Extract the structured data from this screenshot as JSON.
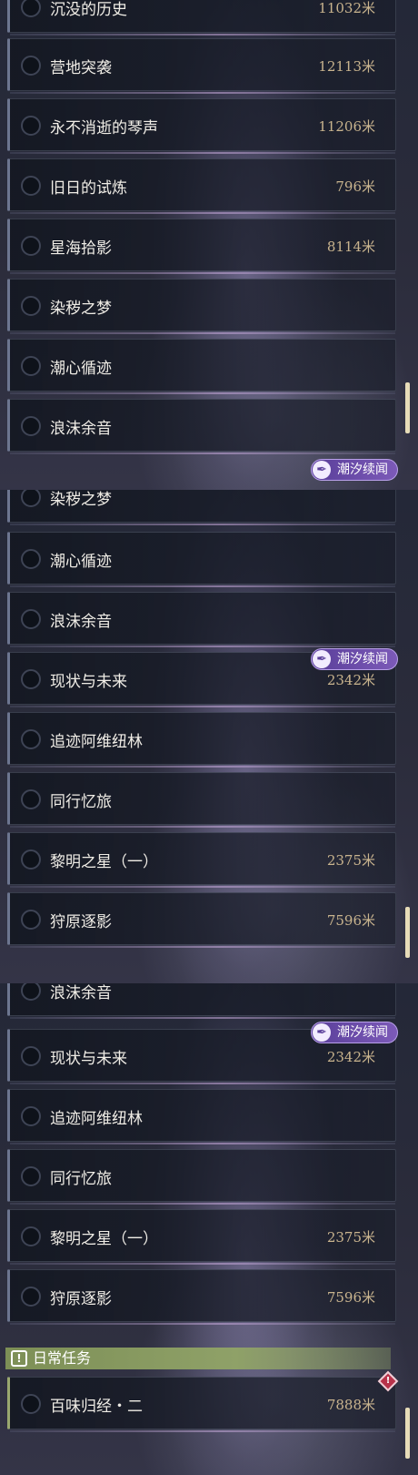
{
  "panels": [
    {
      "quests": [
        {
          "name": "沉没的历史",
          "distance": "11032米"
        },
        {
          "name": "营地突袭",
          "distance": "12113米"
        },
        {
          "name": "永不消逝的琴声",
          "distance": "11206米"
        },
        {
          "name": "旧日的试炼",
          "distance": "796米"
        },
        {
          "name": "星海拾影",
          "distance": "8114米"
        },
        {
          "name": "染秽之梦",
          "distance": ""
        },
        {
          "name": "潮心循迹",
          "distance": ""
        },
        {
          "name": "浪沫余音",
          "distance": ""
        }
      ],
      "tag": "潮汐续闻"
    },
    {
      "quests": [
        {
          "name": "染秽之梦",
          "distance": ""
        },
        {
          "name": "潮心循迹",
          "distance": ""
        },
        {
          "name": "浪沫余音",
          "distance": ""
        },
        {
          "name": "现状与未来",
          "distance": "2342米"
        },
        {
          "name": "追迹阿维纽林",
          "distance": ""
        },
        {
          "name": "同行忆旅",
          "distance": ""
        },
        {
          "name": "黎明之星（一）",
          "distance": "2375米"
        },
        {
          "name": "狩原逐影",
          "distance": "7596米"
        }
      ],
      "tag": "潮汐续闻"
    },
    {
      "quests": [
        {
          "name": "浪沫余音",
          "distance": ""
        },
        {
          "name": "现状与未来",
          "distance": "2342米"
        },
        {
          "name": "追迹阿维纽林",
          "distance": ""
        },
        {
          "name": "同行忆旅",
          "distance": ""
        },
        {
          "name": "黎明之星（一）",
          "distance": "2375米"
        },
        {
          "name": "狩原逐影",
          "distance": "7596米"
        }
      ],
      "tag": "潮汐续闻",
      "section": {
        "title": "日常任务",
        "icon": "!"
      },
      "daily_quests": [
        {
          "name": "百味归经・二",
          "distance": "7888米"
        }
      ]
    }
  ],
  "icons": {
    "tag_icon": "feather-icon",
    "section_icon": "exclamation-icon",
    "alert_icon": "diamond-alert-icon"
  },
  "colors": {
    "tag_purple": "#7c5ab8",
    "section_green": "#8fa168",
    "distance_gold": "#c9b48e",
    "alert_red": "#b8324a"
  }
}
